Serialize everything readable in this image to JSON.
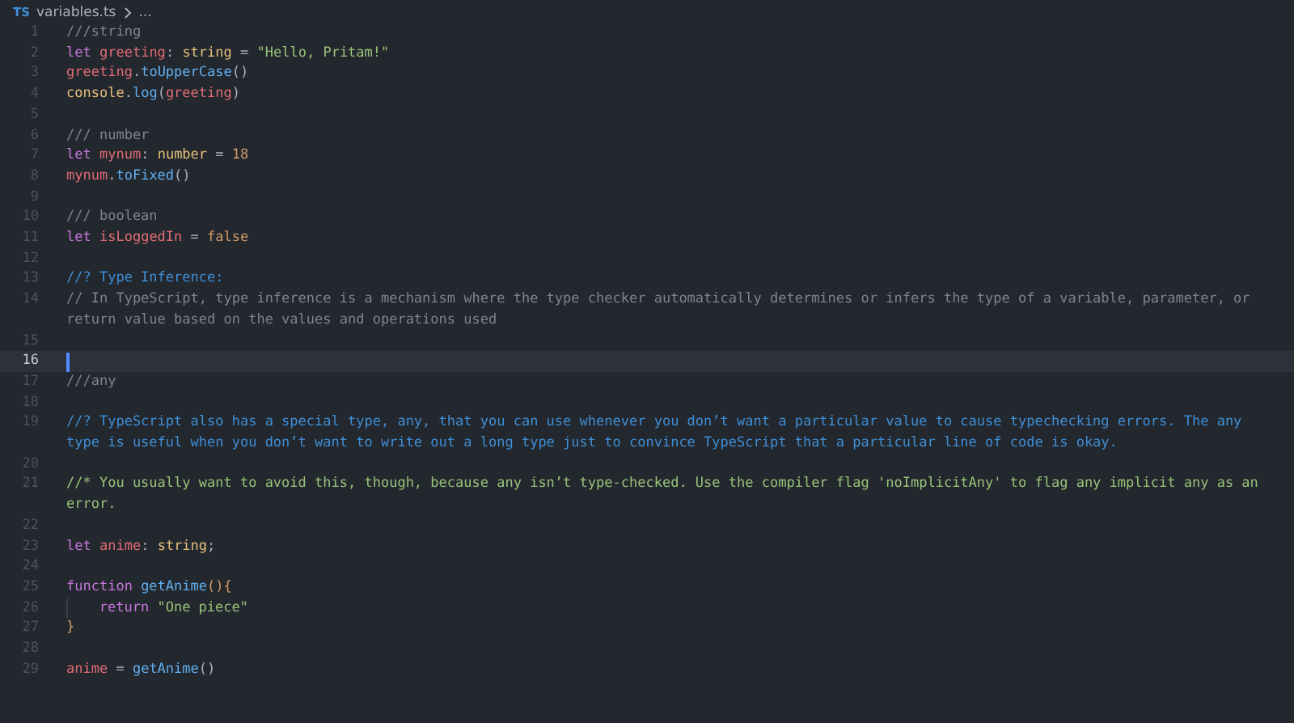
{
  "breadcrumb": {
    "file_icon": "TS",
    "file": "variables.ts",
    "more": "..."
  },
  "lines": [
    {
      "number": "1",
      "current": false,
      "tokens": [
        {
          "text": "///string",
          "kind": "comment"
        }
      ]
    },
    {
      "number": "2",
      "current": false,
      "tokens": [
        {
          "text": "let ",
          "kind": "keyword"
        },
        {
          "text": "greeting",
          "kind": "variable"
        },
        {
          "text": ": ",
          "kind": "plain"
        },
        {
          "text": "string",
          "kind": "type"
        },
        {
          "text": " = ",
          "kind": "plain"
        },
        {
          "text": "\"Hello, Pritam!\"",
          "kind": "string"
        }
      ]
    },
    {
      "number": "3",
      "current": false,
      "tokens": [
        {
          "text": "greeting",
          "kind": "variable"
        },
        {
          "text": ".",
          "kind": "plain"
        },
        {
          "text": "toUpperCase",
          "kind": "function"
        },
        {
          "text": "()",
          "kind": "plain"
        }
      ]
    },
    {
      "number": "4",
      "current": false,
      "tokens": [
        {
          "text": "console",
          "kind": "type"
        },
        {
          "text": ".",
          "kind": "plain"
        },
        {
          "text": "log",
          "kind": "function"
        },
        {
          "text": "(",
          "kind": "plain"
        },
        {
          "text": "greeting",
          "kind": "variable"
        },
        {
          "text": ")",
          "kind": "plain"
        }
      ]
    },
    {
      "number": "5",
      "current": false
    },
    {
      "number": "6",
      "current": false,
      "tokens": [
        {
          "text": "/// number",
          "kind": "comment"
        }
      ]
    },
    {
      "number": "7",
      "current": false,
      "tokens": [
        {
          "text": "let ",
          "kind": "keyword"
        },
        {
          "text": "mynum",
          "kind": "variable"
        },
        {
          "text": ": ",
          "kind": "plain"
        },
        {
          "text": "number",
          "kind": "type"
        },
        {
          "text": " = ",
          "kind": "plain"
        },
        {
          "text": "18",
          "kind": "number"
        }
      ]
    },
    {
      "number": "8",
      "current": false,
      "tokens": [
        {
          "text": "mynum",
          "kind": "variable"
        },
        {
          "text": ".",
          "kind": "plain"
        },
        {
          "text": "toFixed",
          "kind": "function"
        },
        {
          "text": "()",
          "kind": "plain"
        }
      ]
    },
    {
      "number": "9",
      "current": false
    },
    {
      "number": "10",
      "current": false,
      "tokens": [
        {
          "text": "/// boolean",
          "kind": "comment"
        }
      ]
    },
    {
      "number": "11",
      "current": false,
      "tokens": [
        {
          "text": "let ",
          "kind": "keyword"
        },
        {
          "text": "isLoggedIn",
          "kind": "variable"
        },
        {
          "text": " = ",
          "kind": "plain"
        },
        {
          "text": "false",
          "kind": "number"
        }
      ]
    },
    {
      "number": "12",
      "current": false
    },
    {
      "number": "13",
      "current": false,
      "tokens": [
        {
          "text": "//? Type Inference:",
          "kind": "query-comment"
        }
      ]
    },
    {
      "number": "14",
      "current": false,
      "tokens": [
        {
          "text": "// In TypeScript, type inference is a mechanism where the type checker automatically determines or infers the type of a variable, parameter, or return value based on the values and operations used",
          "kind": "comment"
        }
      ]
    },
    {
      "number": "15",
      "current": false
    },
    {
      "number": "16",
      "current": true
    },
    {
      "number": "17",
      "current": false,
      "tokens": [
        {
          "text": "///any",
          "kind": "comment"
        }
      ]
    },
    {
      "number": "18",
      "current": false
    },
    {
      "number": "19",
      "current": false,
      "tokens": [
        {
          "text": "//? TypeScript also has a special type, any, that you can use whenever you don’t want a particular value to cause typechecking errors. The any type is useful when you don’t want to write out a long type just to convince TypeScript that a particular line of code is okay.",
          "kind": "query-comment"
        }
      ]
    },
    {
      "number": "20",
      "current": false
    },
    {
      "number": "21",
      "current": false,
      "tokens": [
        {
          "text": "//* You usually want to avoid this, though, because any isn’t type-checked. Use the compiler flag 'noImplicitAny' to flag any implicit any as an error.",
          "kind": "highlight-comment"
        }
      ]
    },
    {
      "number": "22",
      "current": false
    },
    {
      "number": "23",
      "current": false,
      "tokens": [
        {
          "text": "let ",
          "kind": "keyword"
        },
        {
          "text": "anime",
          "kind": "variable"
        },
        {
          "text": ": ",
          "kind": "plain"
        },
        {
          "text": "string",
          "kind": "type"
        },
        {
          "text": ";",
          "kind": "plain"
        }
      ]
    },
    {
      "number": "24",
      "current": false
    },
    {
      "number": "25",
      "current": false,
      "tokens": [
        {
          "text": "function ",
          "kind": "keyword"
        },
        {
          "text": "getAnime",
          "kind": "function"
        },
        {
          "text": "(){",
          "kind": "bracket"
        }
      ]
    },
    {
      "number": "26",
      "current": false,
      "indented": true,
      "tokens": [
        {
          "text": "return ",
          "kind": "keyword"
        },
        {
          "text": "\"One piece\"",
          "kind": "string"
        }
      ]
    },
    {
      "number": "27",
      "current": false,
      "tokens": [
        {
          "text": "}",
          "kind": "bracket"
        }
      ]
    },
    {
      "number": "28",
      "current": false
    },
    {
      "number": "29",
      "current": false,
      "tokens": [
        {
          "text": "anime",
          "kind": "variable"
        },
        {
          "text": " = ",
          "kind": "plain"
        },
        {
          "text": "getAnime",
          "kind": "function"
        },
        {
          "text": "()",
          "kind": "plain"
        }
      ]
    }
  ]
}
